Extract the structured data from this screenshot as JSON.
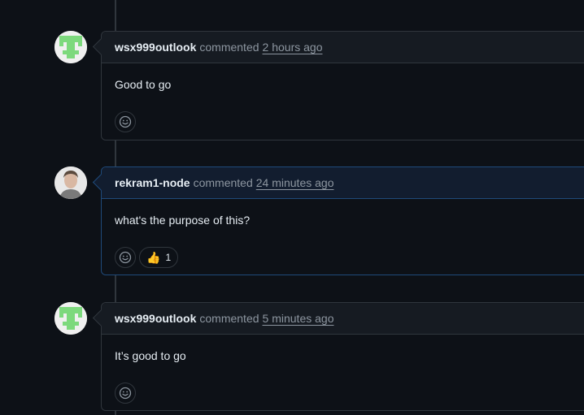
{
  "comments": [
    {
      "author": "wsx999outlook",
      "verb": "commented",
      "time": "2 hours ago",
      "body": "Good to go",
      "avatar": "identicon-green",
      "reactions": []
    },
    {
      "author": "rekram1-node",
      "verb": "commented",
      "time": "24 minutes ago",
      "body": "what's the purpose of this?",
      "avatar": "photo-portrait",
      "reactions": [
        {
          "emoji": "👍",
          "count": "1"
        }
      ]
    },
    {
      "author": "wsx999outlook",
      "verb": "commented",
      "time": "5 minutes ago",
      "body": "It’s good to go",
      "avatar": "identicon-green",
      "reactions": []
    }
  ],
  "icons": {
    "emoji_picker": "smiley-icon"
  },
  "colors": {
    "background": "#0d1117",
    "border": "#30363d",
    "highlight_border": "#1f4a7a",
    "identicon_green": "#7dd97d"
  }
}
